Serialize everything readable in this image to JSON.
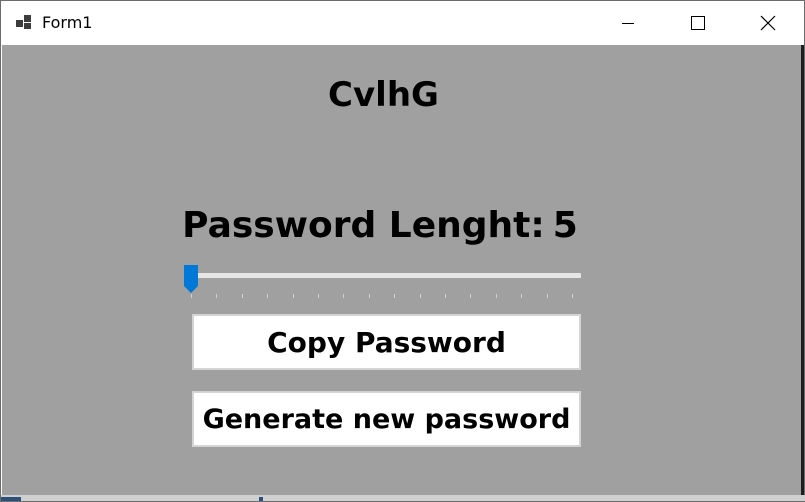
{
  "window": {
    "title": "Form1",
    "icon": "winforms-app-icon",
    "minimize_icon": "minimize-icon",
    "maximize_icon": "maximize-icon",
    "close_icon": "close-icon"
  },
  "main": {
    "password": "CvlhG",
    "length_label": "Password Lenght:",
    "length_value": "5",
    "slider": {
      "value": 5,
      "accent_color": "#0078d7"
    },
    "copy_button_label": "Copy Password",
    "generate_button_label": "Generate new password"
  },
  "colors": {
    "client_background": "#a0a0a0",
    "button_background": "#ffffff"
  }
}
